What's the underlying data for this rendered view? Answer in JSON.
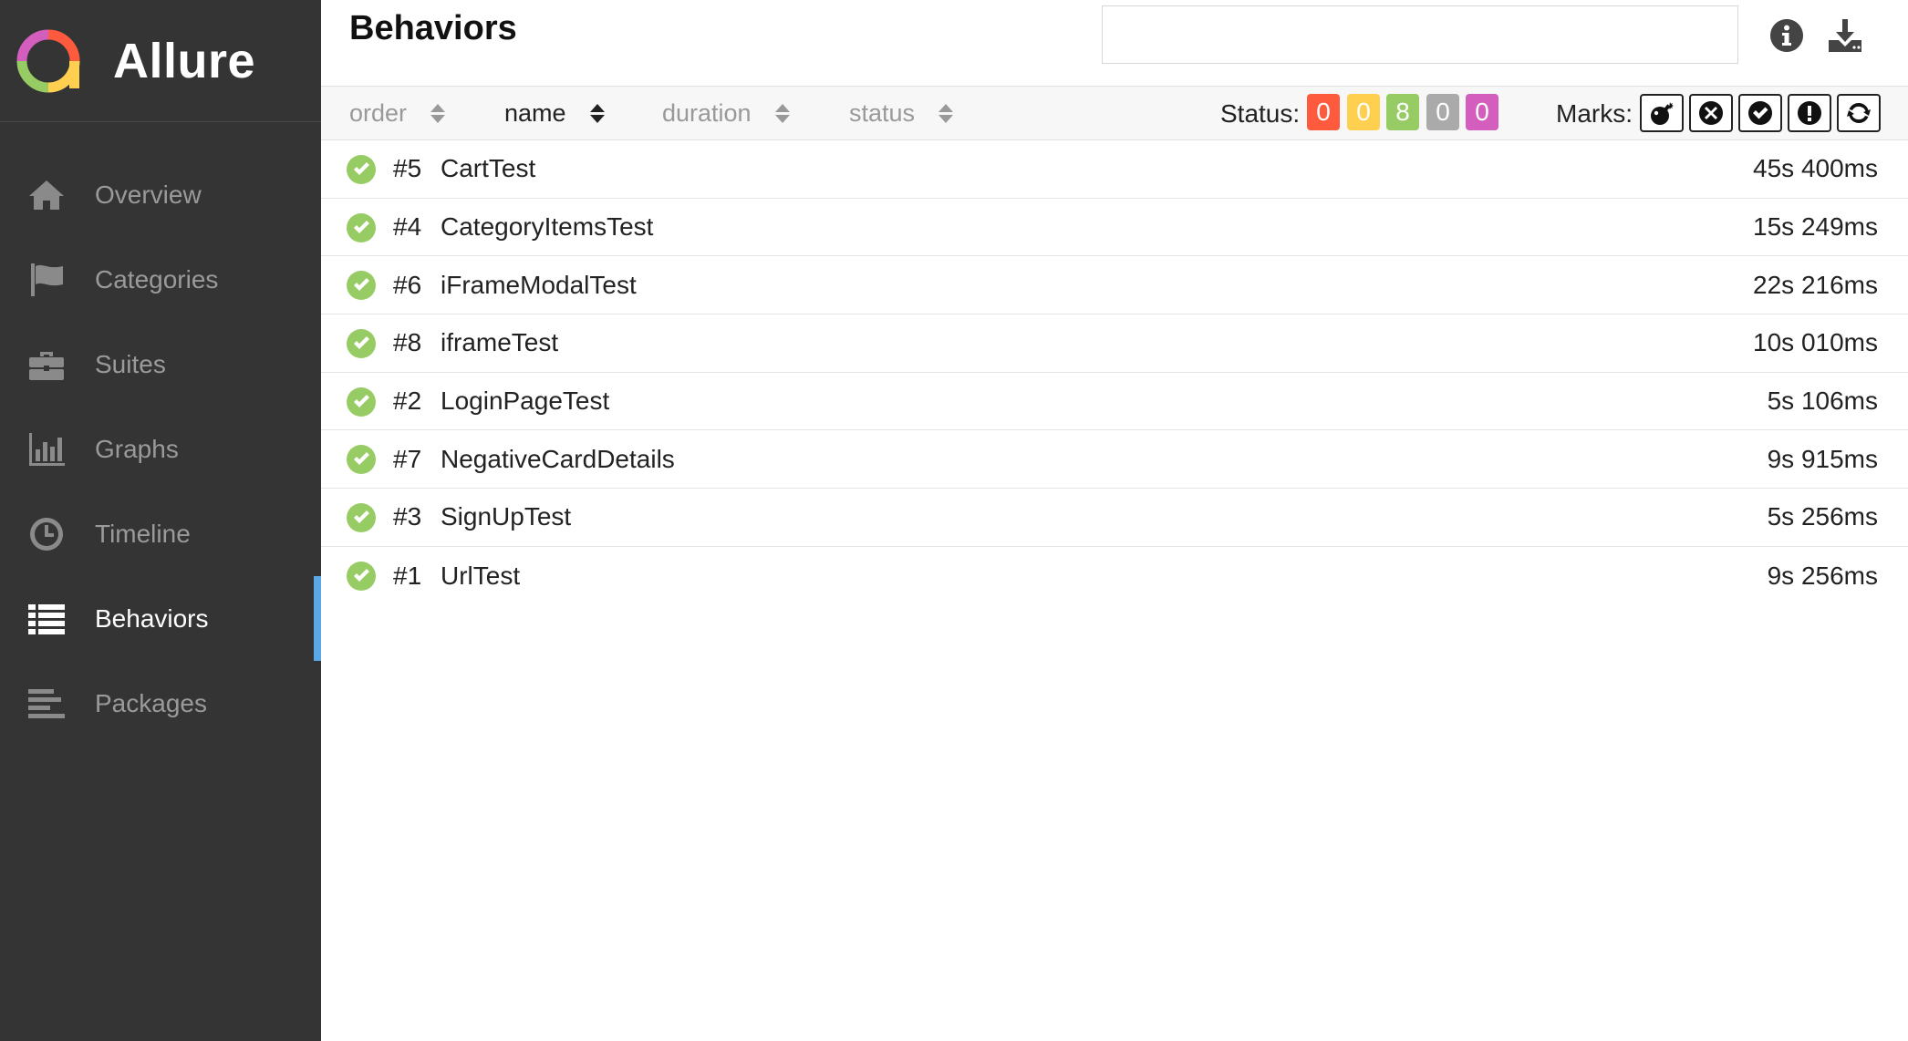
{
  "brand": {
    "name": "Allure"
  },
  "sidebar": {
    "items": [
      {
        "label": "Overview",
        "icon": "home-icon"
      },
      {
        "label": "Categories",
        "icon": "flag-icon"
      },
      {
        "label": "Suites",
        "icon": "briefcase-icon"
      },
      {
        "label": "Graphs",
        "icon": "bar-chart-icon"
      },
      {
        "label": "Timeline",
        "icon": "clock-icon"
      },
      {
        "label": "Behaviors",
        "icon": "list-icon",
        "active": true
      },
      {
        "label": "Packages",
        "icon": "align-left-icon"
      }
    ]
  },
  "header": {
    "title": "Behaviors",
    "search": {
      "value": "",
      "placeholder": ""
    },
    "info_icon": "info-icon",
    "download_icon": "download-icon"
  },
  "toolbar": {
    "sort": {
      "order": "order",
      "name": "name",
      "duration": "duration",
      "status": "status"
    },
    "active_sort": "name",
    "status_label": "Status:",
    "statuses": [
      {
        "name": "failed",
        "count": "0",
        "color": "#fd5a3e"
      },
      {
        "name": "broken",
        "count": "0",
        "color": "#ffd050"
      },
      {
        "name": "passed",
        "count": "8",
        "color": "#97cc64"
      },
      {
        "name": "skipped",
        "count": "0",
        "color": "#aaaaaa"
      },
      {
        "name": "unknown",
        "count": "0",
        "color": "#d35ebe"
      }
    ],
    "marks_label": "Marks:",
    "marks": [
      "flaky-bomb-icon",
      "new-failed-icon",
      "new-passed-icon",
      "new-broken-icon",
      "retries-icon"
    ]
  },
  "tests": [
    {
      "order": "#5",
      "name": "CartTest",
      "duration": "45s 400ms",
      "status": "passed"
    },
    {
      "order": "#4",
      "name": "CategoryItemsTest",
      "duration": "15s 249ms",
      "status": "passed"
    },
    {
      "order": "#6",
      "name": "iFrameModalTest",
      "duration": "22s 216ms",
      "status": "passed"
    },
    {
      "order": "#8",
      "name": "iframeTest",
      "duration": "10s 010ms",
      "status": "passed"
    },
    {
      "order": "#2",
      "name": "LoginPageTest",
      "duration": "5s 106ms",
      "status": "passed"
    },
    {
      "order": "#7",
      "name": "NegativeCardDetails",
      "duration": "9s 915ms",
      "status": "passed"
    },
    {
      "order": "#3",
      "name": "SignUpTest",
      "duration": "5s 256ms",
      "status": "passed"
    },
    {
      "order": "#1",
      "name": "UrlTest",
      "duration": "9s 256ms",
      "status": "passed"
    }
  ],
  "colors": {
    "sidebar_bg": "#343434",
    "active_indicator": "#5aa9e6",
    "passed": "#97cc64"
  }
}
